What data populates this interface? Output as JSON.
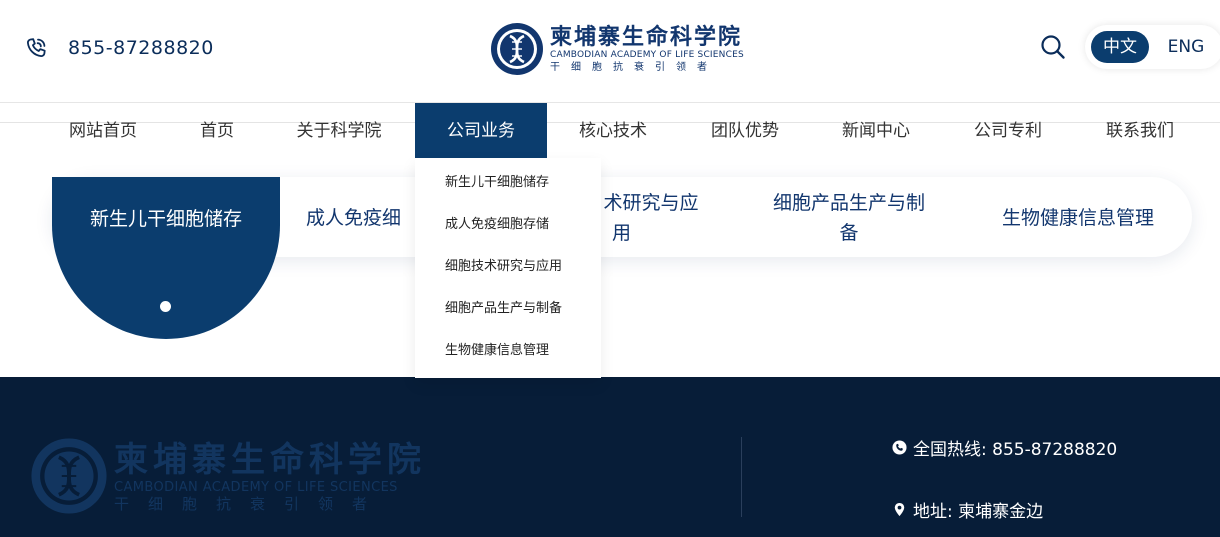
{
  "header": {
    "phone": "855-87288820",
    "logo": {
      "cn": "柬埔寨生命科学院",
      "en": "CAMBODIAN ACADEMY OF LIFE SCIENCES",
      "tagline": "干细胞抗衰引领者"
    },
    "lang": {
      "cn": "中文",
      "en": "ENG",
      "active": "cn"
    }
  },
  "nav": {
    "items": [
      {
        "label": "网站首页"
      },
      {
        "label": "首页"
      },
      {
        "label": "关于科学院"
      },
      {
        "label": "公司业务",
        "active": true
      },
      {
        "label": "核心技术"
      },
      {
        "label": "团队优势"
      },
      {
        "label": "新闻中心"
      },
      {
        "label": "公司专利"
      },
      {
        "label": "联系我们"
      }
    ],
    "dropdown": [
      "新生儿干细胞储存",
      "成人免疫细胞存储",
      "细胞技术研究与应用",
      "细胞产品生产与制备",
      "生物健康信息管理"
    ]
  },
  "business_tabs": {
    "active": "新生儿干细胞储存",
    "tab2_visible": "成人免疫细",
    "tab3_line1": "术研究与应",
    "tab3_line2": "用",
    "tab4_line1": "细胞产品生产与制",
    "tab4_line2": "备",
    "tab5": "生物健康信息管理"
  },
  "footer": {
    "hotline": "全国热线: 855-87288820",
    "address": "地址: 柬埔寨金边"
  },
  "colors": {
    "primary": "#0b3d6e",
    "footer_bg": "#071d38",
    "text_dark": "#333333"
  }
}
